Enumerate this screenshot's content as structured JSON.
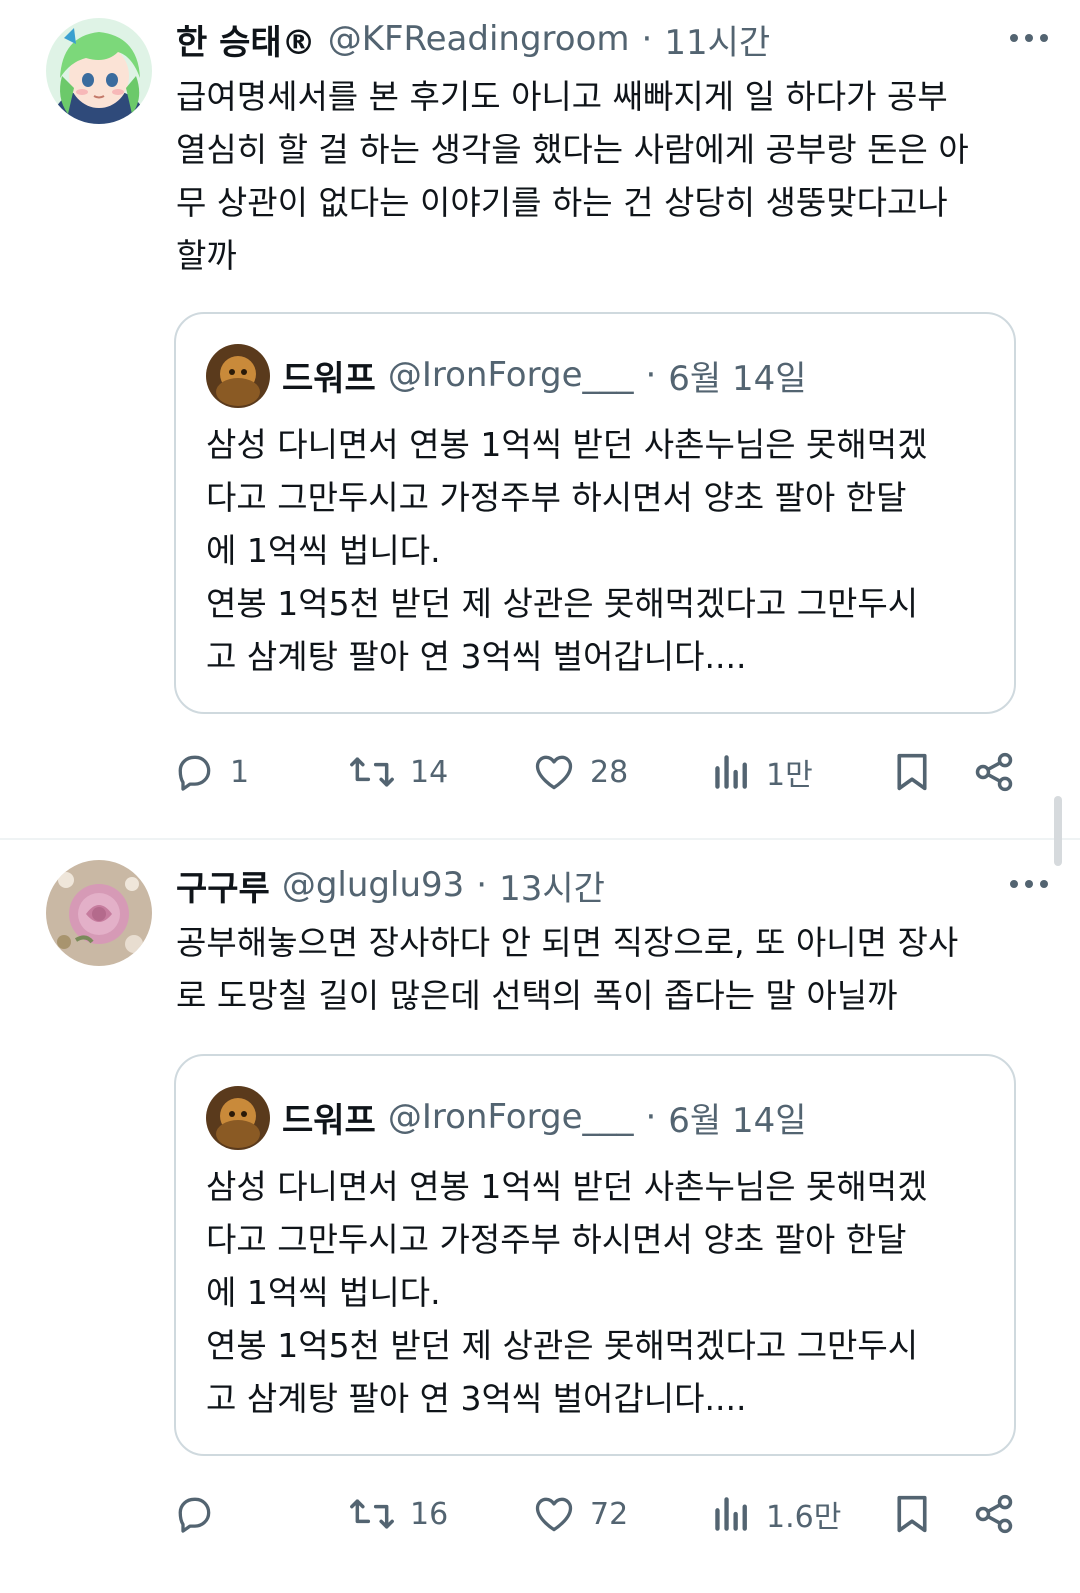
{
  "tweets": [
    {
      "author_name": "한 승태®",
      "handle": "@KFReadingroom",
      "separator": "·",
      "time": "11시간",
      "body_lines": [
        "급여명세서를 본 후기도 아니고 쌔빠지게 일 하다가 공부",
        "열심히 할 걸 하는 생각을 했다는 사람에게 공부랑 돈은 아",
        "무 상관이 없다는 이야기를 하는 건 상당히 생뚱맞다고나",
        "할까"
      ],
      "quote": {
        "author_name": "드워프",
        "handle": "@IronForge___",
        "separator": "·",
        "date": "6월 14일",
        "lines": [
          "삼성 다니면서 연봉 1억씩 받던 사촌누님은 못해먹겠",
          "다고 그만두시고 가정주부 하시면서 양초 팔아 한달",
          "에 1억씩 법니다.",
          "연봉 1억5천 받던 제 상관은 못해먹겠다고 그만두시",
          "고 삼계탕 팔아 연 3억씩 벌어갑니다...."
        ]
      },
      "actions": {
        "replies": "1",
        "retweets": "14",
        "likes": "28",
        "views": "1만"
      }
    },
    {
      "author_name": "구구루",
      "handle": "@gluglu93",
      "separator": "·",
      "time": "13시간",
      "body_lines": [
        "공부해놓으면 장사하다 안 되면 직장으로, 또 아니면 장사",
        "로 도망칠 길이 많은데 선택의 폭이 좁다는 말 아닐까"
      ],
      "quote": {
        "author_name": "드워프",
        "handle": "@IronForge___",
        "separator": "·",
        "date": "6월 14일",
        "lines": [
          "삼성 다니면서 연봉 1억씩 받던 사촌누님은 못해먹겠",
          "다고 그만두시고 가정주부 하시면서 양초 팔아 한달",
          "에 1억씩 법니다.",
          "연봉 1억5천 받던 제 상관은 못해먹겠다고 그만두시",
          "고 삼계탕 팔아 연 3억씩 벌어갑니다...."
        ]
      },
      "actions": {
        "replies": "",
        "retweets": "16",
        "likes": "72",
        "views": "1.6만"
      }
    }
  ],
  "icons": {
    "reply": "reply-icon",
    "retweet": "retweet-icon",
    "like": "heart-icon",
    "views": "views-icon",
    "bookmark": "bookmark-icon",
    "share": "share-icon",
    "more": "more-icon"
  },
  "colors": {
    "text": "#0f1419",
    "secondary": "#536471",
    "border": "#cfd9de",
    "divider": "#eff3f4"
  }
}
